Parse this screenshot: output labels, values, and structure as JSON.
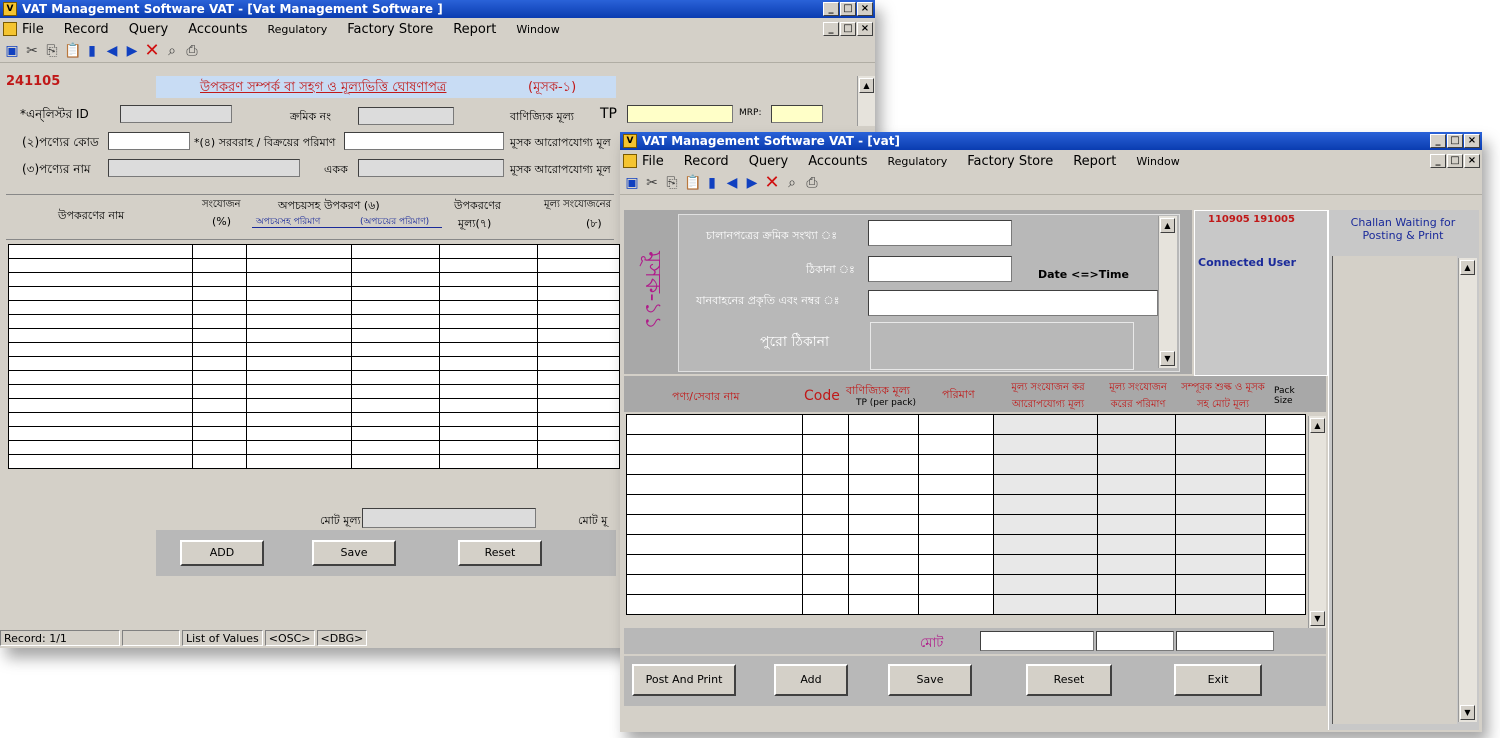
{
  "window1": {
    "title": "VAT Management Software  VAT - [Vat Management Software ]",
    "menu": [
      "File",
      "Record",
      "Query",
      "Accounts",
      "Regulatory",
      "Factory Store",
      "Report",
      "Window"
    ],
    "form_id": "241105",
    "form_title": "উপকরণ সম্পর্ক বা সহগ ও মূল্যভিত্তি ঘোষণাপত্র",
    "form_code": "(মূসক-১)",
    "labels": {
      "enlist_id": "*এন্‌লিস্টর ID",
      "serial_no": "ক্রমিক নং",
      "commercial_price": "বাণিজ্যিক মূল্য",
      "tp": "TP",
      "mrp": "MRP:",
      "product_code": "(২)পণ্যের কোড",
      "supply_qty": "*(৪) সরবরাহ / বিক্রয়ের পরিমাণ",
      "vat_price_1": "মূসক আরোপযোগ্য মূল",
      "product_name": "(৩)পণ্যের নাম",
      "unit": "একক",
      "vat_price_2": "মূসক আরোপযোগ্য মূল",
      "total_price": "মোট মূল্য",
      "total_2": "মোট মূ"
    },
    "columns": {
      "material_name": "উপকরণের নাম",
      "addition": "সংযোজন",
      "addition_pct": "(%)",
      "wastage_material": "অপচয়সহ উপকরণ (৬)",
      "with_wastage": "অপচয়সহ পরিমাণ",
      "wastage_amount": "(অপচয়ের পরিমাণ)",
      "material_price_1": "উপকরণের",
      "material_price_2": "মূল্য(৭)",
      "value_added_1": "মূল্য সংযোজনের",
      "value_added_2": "(৮)"
    },
    "buttons": {
      "add": "ADD",
      "save": "Save",
      "reset": "Reset"
    },
    "status": {
      "record": "Record: 1/1",
      "lov": "List of Values",
      "osc": "<OSC>",
      "dbg": "<DBG>"
    }
  },
  "window2": {
    "title": "VAT Management Software  VAT - [vat]",
    "menu": [
      "File",
      "Record",
      "Query",
      "Accounts",
      "Regulatory",
      "Factory Store",
      "Report",
      "Window"
    ],
    "side_stamp": "মূসক-১১",
    "labels": {
      "challan_no": "চালানপত্রের ক্রমিক সংখ্যা ঃ",
      "address": "ঠিকানা ঃ",
      "date_time": "Date <=>Time",
      "vehicle": "যানবাহনের প্রকৃতি এবং নম্বর ঃ",
      "full_address": "পুরো ঠিকানা"
    },
    "code_ids": "110905 191005",
    "connected_user": "Connected User",
    "challan_waiting": "Challan Waiting for Posting & Print",
    "columns": {
      "product": "পণ্য/সেবার নাম",
      "code": "Code",
      "commercial_price": "বাণিজ্যিক মূল্য",
      "tp_per_pack": "TP (per pack)",
      "quantity": "পরিমাণ",
      "vat_taxable": "মূল্য সংযোজন কর আরোপযোগ্য মূল্য",
      "vat_amount": "মূল্য সংযোজন করের পরিমাণ",
      "total_with_duty": "সম্পূরক শুল্ক ও মূসক সহ মোট মূল্য",
      "pack_size": "Pack Size"
    },
    "total_label": "মোট",
    "buttons": {
      "post_print": "Post And Print",
      "add": "Add",
      "save": "Save",
      "reset": "Reset",
      "exit": "Exit"
    }
  },
  "colors": {
    "title_bar": "#0a3cb0",
    "window_bg": "#d4d0c8",
    "form_header": "#c8dcf4",
    "accent_red": "#c01818",
    "accent_navy": "#1a2a9a"
  }
}
